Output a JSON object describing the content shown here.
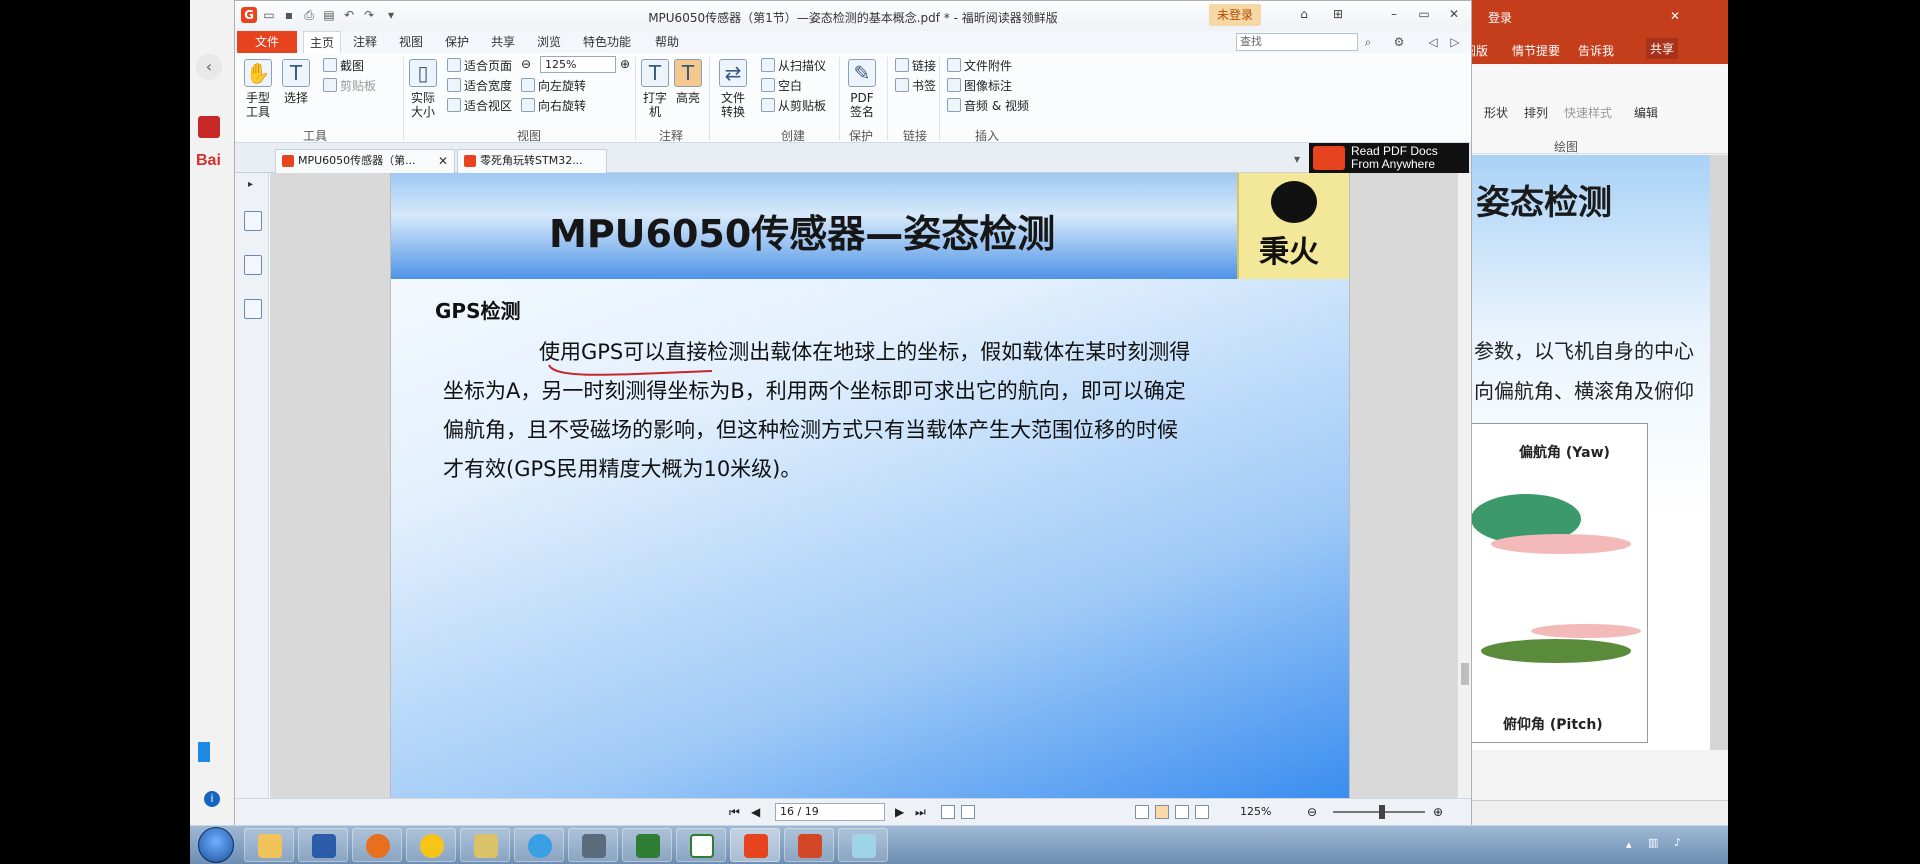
{
  "background_ppt": {
    "login_label": "登录",
    "share_label": "共享",
    "tabs": [
      "阅版",
      "情节提要",
      "告诉我"
    ],
    "ribbon": {
      "shape": "形状",
      "arrange": "排列",
      "quick_styles": "快速样式",
      "edit": "编辑",
      "group_label": "绘图"
    },
    "slide_title": "姿态检测",
    "slide_lines": [
      "参数，以飞机自身的中心",
      "向偏航角、横滚角及俯仰"
    ],
    "figure_captions": {
      "yaw": "偏航角 (Yaw)",
      "pitch": "俯仰角 (Pitch)"
    }
  },
  "foxit": {
    "window_title": "MPU6050传感器（第1节）—姿态检测的基本概念.pdf * - 福昕阅读器领鲜版",
    "login_button": "未登录",
    "menus": [
      "文件",
      "主页",
      "注释",
      "视图",
      "保护",
      "共享",
      "浏览",
      "特色功能",
      "帮助"
    ],
    "search_placeholder": "查找",
    "ribbon": {
      "hand_tool": "手型工具",
      "select": "选择",
      "screenshot": "截图",
      "clipboard": "剪贴板",
      "tools_group": "工具",
      "actual_size": "实际大小",
      "fit_page": "适合页面",
      "fit_width": "适合宽度",
      "fit_visible": "适合视区",
      "zoom": "125%",
      "rotate_left": "向左旋转",
      "rotate_right": "向右旋转",
      "view_group": "视图",
      "typewriter": "打字机",
      "highlight": "高亮",
      "comment_group": "注释",
      "file_convert": "文件转换",
      "from_scanner": "从扫描仪",
      "blank": "空白",
      "from_clipboard": "从剪贴板",
      "create_group": "创建",
      "pdf_sign": "PDF签名",
      "protect_group": "保护",
      "link": "链接",
      "bookmark": "书签",
      "links_group": "链接",
      "file_attachment": "文件附件",
      "image_annotation": "图像标注",
      "audio_video": "音频 & 视频",
      "insert_group": "插入"
    },
    "tabs": [
      "MPU6050传感器（第...",
      "零死角玩转STM32..."
    ],
    "promo": [
      "Read PDF Docs",
      "From Anywhere"
    ],
    "page": {
      "title": "MPU6050传感器—姿态检测",
      "logo_text": "秉火",
      "section": "GPS检测",
      "lines": [
        "使用GPS可以直接检测出载体在地球上的坐标，假如载体在某时刻测得",
        "坐标为A，另一时刻测得坐标为B，利用两个坐标即可求出它的航向，即可以确定",
        "偏航角，且不受磁场的影响，但这种检测方式只有当载体产生大范围位移的时候",
        "才有效(GPS民用精度大概为10米级)。"
      ]
    },
    "status": {
      "page_indicator": "16 / 19",
      "zoom": "125%"
    }
  },
  "colors": {
    "foxit_accent": "#e8431f",
    "ppt_accent": "#c43e1c",
    "annotation": "#c62828"
  }
}
